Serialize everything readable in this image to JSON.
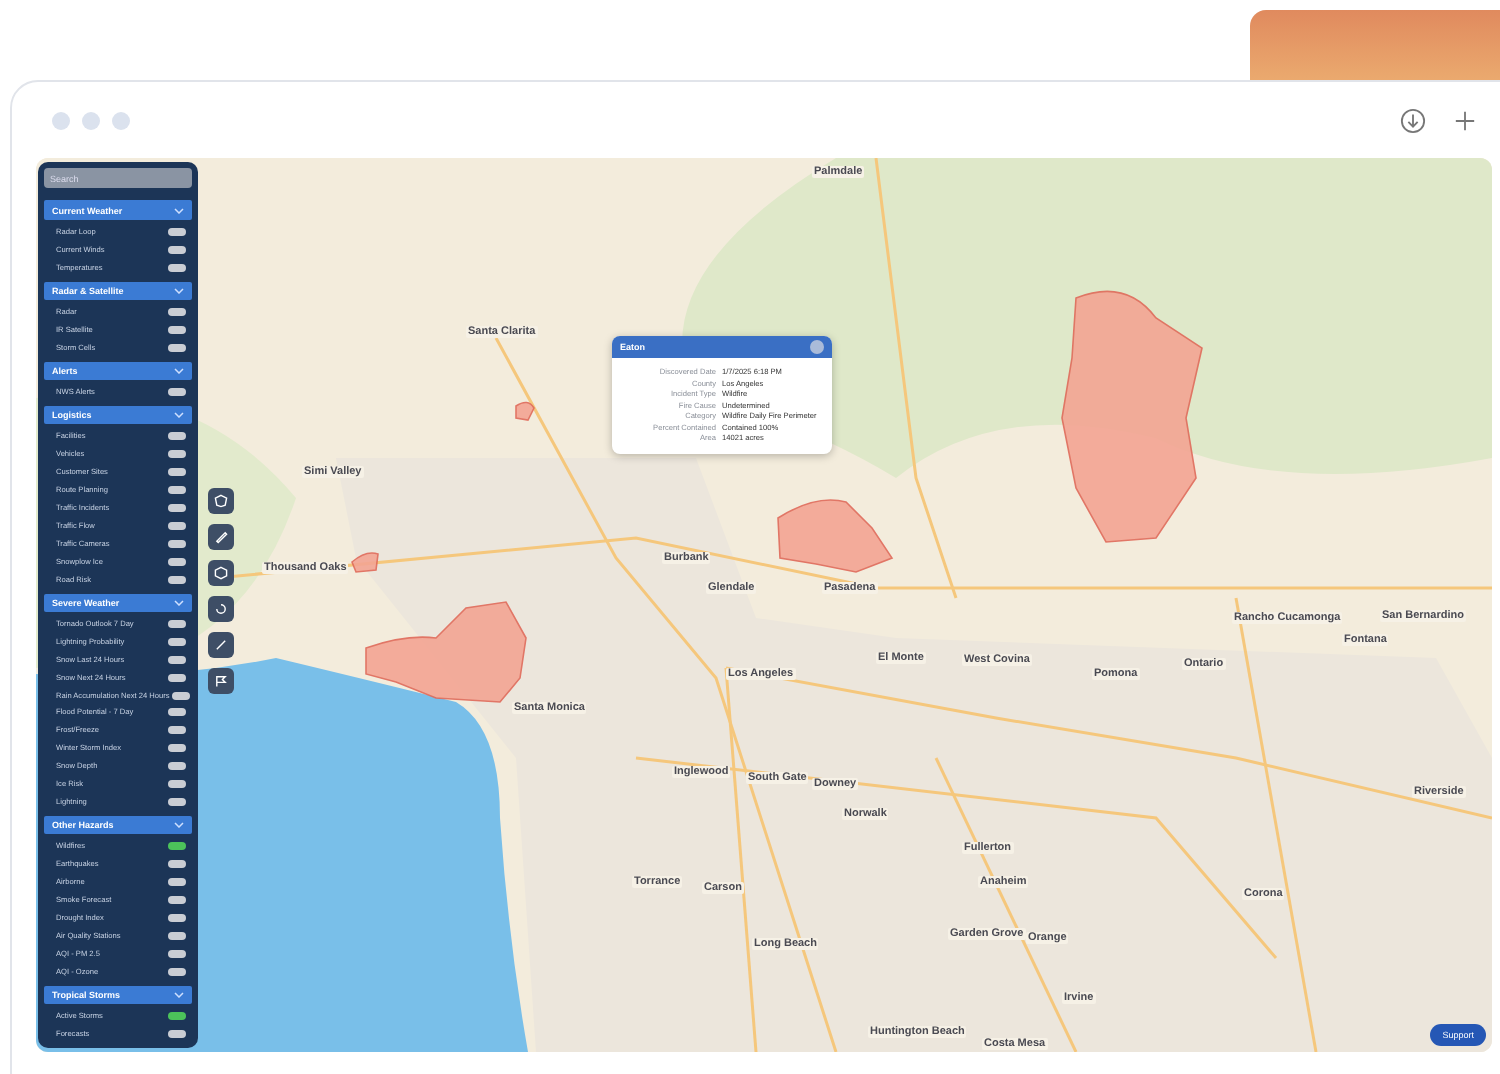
{
  "sidebar": {
    "search": {
      "placeholder": "Search"
    },
    "sections": [
      {
        "title": "Current Weather",
        "expanded": true,
        "items": [
          {
            "label": "Radar Loop",
            "on": false
          },
          {
            "label": "Current Winds",
            "on": false
          },
          {
            "label": "Temperatures",
            "on": false
          }
        ]
      },
      {
        "title": "Radar & Satellite",
        "expanded": true,
        "items": [
          {
            "label": "Radar",
            "on": false
          },
          {
            "label": "IR Satellite",
            "on": false
          },
          {
            "label": "Storm Cells",
            "on": false
          }
        ]
      },
      {
        "title": "Alerts",
        "expanded": true,
        "items": [
          {
            "label": "NWS Alerts",
            "on": false
          }
        ]
      },
      {
        "title": "Logistics",
        "expanded": true,
        "items": [
          {
            "label": "Facilities",
            "on": false
          },
          {
            "label": "Vehicles",
            "on": false
          },
          {
            "label": "Customer Sites",
            "on": false
          },
          {
            "label": "Route Planning",
            "on": false
          },
          {
            "label": "Traffic Incidents",
            "on": false
          },
          {
            "label": "Traffic Flow",
            "on": false
          },
          {
            "label": "Traffic Cameras",
            "on": false
          },
          {
            "label": "Snowplow Ice",
            "on": false
          },
          {
            "label": "Road Risk",
            "on": false
          }
        ]
      },
      {
        "title": "Severe Weather",
        "expanded": true,
        "items": [
          {
            "label": "Tornado Outlook 7 Day",
            "on": false
          },
          {
            "label": "Lightning Probability",
            "on": false
          },
          {
            "label": "Snow Last 24 Hours",
            "on": false
          },
          {
            "label": "Snow Next 24 Hours",
            "on": false
          },
          {
            "label": "Rain Accumulation Next 24 Hours",
            "on": false
          },
          {
            "label": "Flood Potential - 7 Day",
            "on": false
          },
          {
            "label": "Frost/Freeze",
            "on": false
          },
          {
            "label": "Winter Storm Index",
            "on": false
          },
          {
            "label": "Snow Depth",
            "on": false
          },
          {
            "label": "Ice Risk",
            "on": false
          },
          {
            "label": "Lightning",
            "on": false
          }
        ]
      },
      {
        "title": "Other Hazards",
        "expanded": true,
        "items": [
          {
            "label": "Wildfires",
            "on": true
          },
          {
            "label": "Earthquakes",
            "on": false
          },
          {
            "label": "Airborne",
            "on": false
          },
          {
            "label": "Smoke Forecast",
            "on": false
          },
          {
            "label": "Drought Index",
            "on": false
          },
          {
            "label": "Air Quality Stations",
            "on": false
          },
          {
            "label": "AQI - PM 2.5",
            "on": false
          },
          {
            "label": "AQI - Ozone",
            "on": false
          }
        ]
      },
      {
        "title": "Tropical Storms",
        "expanded": true,
        "items": [
          {
            "label": "Active Storms",
            "on": true
          },
          {
            "label": "Forecasts",
            "on": false
          }
        ]
      }
    ]
  },
  "popup": {
    "title": "Eaton",
    "rows": [
      {
        "label": "Discovered Date",
        "value": "1/7/2025 6:18 PM"
      },
      {
        "label": "County",
        "value": "Los Angeles"
      },
      {
        "label": "Incident Type",
        "value": "Wildfire"
      },
      {
        "label": "Fire Cause",
        "value": "Undetermined"
      },
      {
        "label": "Category",
        "value": "Wildfire Daily Fire Perimeter"
      },
      {
        "label": "Percent Contained",
        "value": "Contained 100%"
      },
      {
        "label": "Area",
        "value": "14021 acres"
      }
    ]
  },
  "map_labels": [
    "Palmdale",
    "Santa Clarita",
    "Simi Valley",
    "Thousand Oaks",
    "Burbank",
    "Glendale",
    "Pasadena",
    "Santa Monica",
    "Los Angeles",
    "El Monte",
    "West Covina",
    "Pomona",
    "Ontario",
    "Rancho Cucamonga",
    "Fontana",
    "San Bernardino",
    "Inglewood",
    "South Gate",
    "Downey",
    "Norwalk",
    "Torrance",
    "Carson",
    "Long Beach",
    "Fullerton",
    "Anaheim",
    "Garden Grove",
    "Orange",
    "Huntington Beach",
    "Costa Mesa",
    "Irvine",
    "Corona",
    "Riverside"
  ],
  "bottom_bar": {
    "support": "Support"
  }
}
